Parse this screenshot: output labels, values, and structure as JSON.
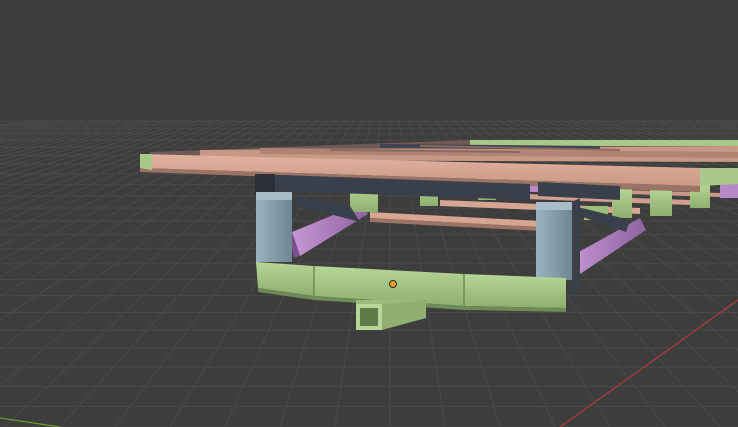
{
  "viewport": {
    "background_color": "#3d3d3d",
    "grid_line_color": "#4a4a4a",
    "x_axis_color": "#b23a3a",
    "y_axis_color": "#6a9a2a"
  },
  "model": {
    "name": "",
    "colors": {
      "plank_top": "#d9a893",
      "plank_side": "#b98a79",
      "plank_dark": "#8f6a5e",
      "crossbar_green": "#a9c98a",
      "crossbar_green_dark": "#7e9c64",
      "post_blue": "#8fa6b2",
      "post_blue_dark": "#5e7480",
      "beam_dark": "#3a3f4c",
      "rail_purple": "#b789c6",
      "rail_purple_dark": "#8a5f99",
      "origin_marker": "#f0a020"
    },
    "origin_icon": "object-origin-icon"
  }
}
